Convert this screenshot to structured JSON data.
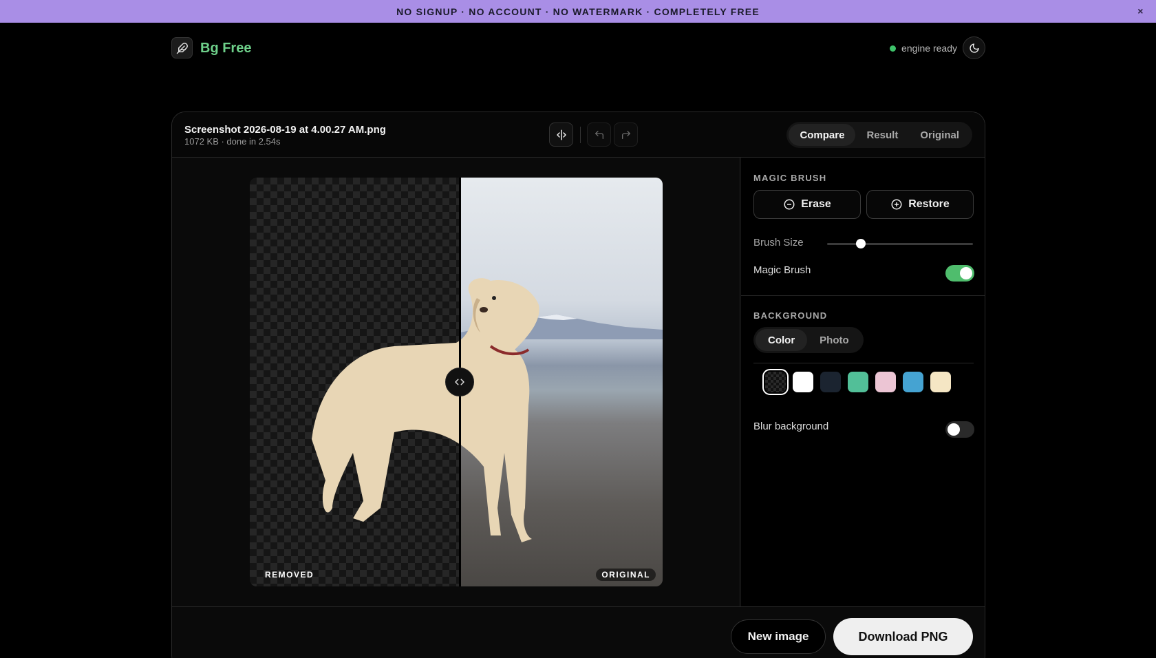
{
  "banner": {
    "text": "NO SIGNUP · NO ACCOUNT · NO WATERMARK · COMPLETELY FREE",
    "close": "×"
  },
  "header": {
    "app_name": "Bg Free",
    "status": "engine ready",
    "accent": "#6ed08a",
    "status_color": "#3ec26a"
  },
  "file": {
    "name": "Screenshot 2026-08-19 at 4.00.27 AM.png",
    "meta": "1072 KB · done in 2.54s"
  },
  "view_modes": [
    "Compare",
    "Result",
    "Original"
  ],
  "active_view": "Compare",
  "viewer": {
    "left_label": "REMOVED",
    "right_label": "ORIGINAL",
    "split_percent": 51
  },
  "magic_brush": {
    "title": "MAGIC BRUSH",
    "erase_label": "Erase",
    "restore_label": "Restore",
    "brush_size_label": "Brush Size",
    "brush_size_fraction": 0.23,
    "toggle_label": "Magic Brush",
    "toggle_on": true
  },
  "background": {
    "title": "BACKGROUND",
    "tabs": [
      "Color",
      "Photo"
    ],
    "active_tab": "Color",
    "swatches": [
      "transparent",
      "#ffffff",
      "#1b2430",
      "#52bf98",
      "#ecc5d4",
      "#45a3d2",
      "#f5e6c4"
    ],
    "blur_label": "Blur background",
    "blur_on": false
  },
  "actions": {
    "new_image": "New image",
    "download": "Download PNG"
  }
}
